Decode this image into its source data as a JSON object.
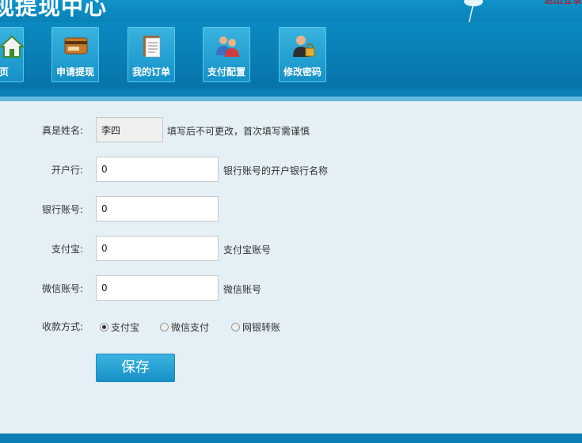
{
  "header": {
    "title": "现提现中心",
    "user_link": "退出登录"
  },
  "nav": {
    "items": [
      {
        "label": "页",
        "icon": "home-icon"
      },
      {
        "label": "申请提现",
        "icon": "card-icon"
      },
      {
        "label": "我的订单",
        "icon": "clipboard-icon"
      },
      {
        "label": "支付配置",
        "icon": "users-icon"
      },
      {
        "label": "修改密码",
        "icon": "user-lock-icon"
      }
    ]
  },
  "form": {
    "real_name": {
      "label": "真是姓名:",
      "value": "李四",
      "hint": "填写后不可更改，首次填写需谨慎"
    },
    "bank": {
      "label": "开户行:",
      "value": "0",
      "hint": "银行账号的开户银行名称"
    },
    "bank_account": {
      "label": "银行账号:",
      "value": "0"
    },
    "alipay": {
      "label": "支付宝:",
      "value": "0",
      "hint": "支付宝账号"
    },
    "wechat": {
      "label": "微信账号:",
      "value": "0",
      "hint": "微信账号"
    },
    "payment_method": {
      "label": "收款方式:",
      "options": [
        "支付宝",
        "微信支付",
        "网银转账"
      ],
      "selected": "支付宝"
    },
    "save_label": "保存"
  },
  "colors": {
    "header_bg": "#0f93c9",
    "nav_bg": "#0b8ac1",
    "button_bg": "#2aa3d6",
    "page_bg": "#e4f0f6"
  }
}
